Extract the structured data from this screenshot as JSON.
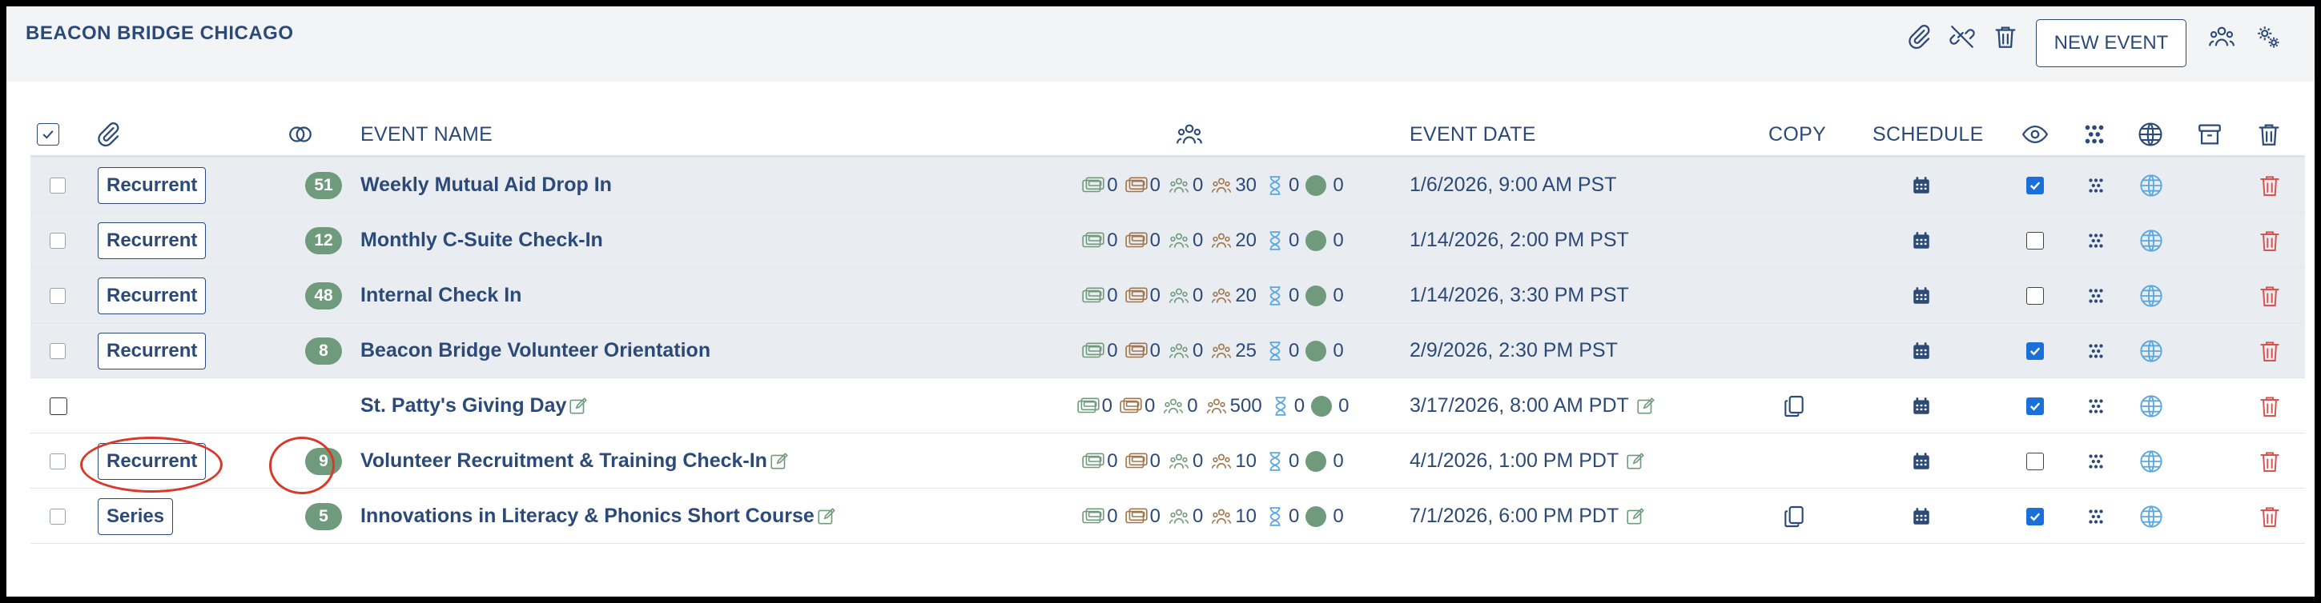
{
  "org": {
    "title": "BEACON BRIDGE CHICAGO"
  },
  "toolbar": {
    "new_event_label": "NEW EVENT",
    "icons": [
      "paperclip-icon",
      "unlink-icon",
      "trash-icon",
      "users-icon",
      "gears-icon"
    ]
  },
  "columns": {
    "event_name": "EVENT NAME",
    "event_date": "EVENT DATE",
    "copy": "COPY",
    "schedule": "SCHEDULE"
  },
  "colors": {
    "primary": "#2c4a78",
    "badge_green": "#6f9a7c",
    "row_shade": "#e9ecf1",
    "checkbox_blue": "#1a6fd8",
    "trash_red": "#d9534f",
    "globe_blue": "#5aa7e0",
    "annotation_red": "#d83a2a"
  },
  "rows": [
    {
      "tag": "Recurrent",
      "count": "51",
      "name": "Weekly Mutual Aid Drop In",
      "editable": false,
      "s1": "0",
      "s2": "0",
      "s3": "0",
      "s4": "30",
      "s5": "0",
      "s6": "0",
      "date": "1/6/2026, 9:00 AM PST",
      "copy": false,
      "visible": true
    },
    {
      "tag": "Recurrent",
      "count": "12",
      "name": "Monthly C-Suite Check-In",
      "editable": false,
      "s1": "0",
      "s2": "0",
      "s3": "0",
      "s4": "20",
      "s5": "0",
      "s6": "0",
      "date": "1/14/2026, 2:00 PM PST",
      "copy": false,
      "visible": false
    },
    {
      "tag": "Recurrent",
      "count": "48",
      "name": "Internal Check In",
      "editable": false,
      "s1": "0",
      "s2": "0",
      "s3": "0",
      "s4": "20",
      "s5": "0",
      "s6": "0",
      "date": "1/14/2026, 3:30 PM PST",
      "copy": false,
      "visible": false
    },
    {
      "tag": "Recurrent",
      "count": "8",
      "name": "Beacon Bridge Volunteer Orientation",
      "editable": false,
      "s1": "0",
      "s2": "0",
      "s3": "0",
      "s4": "25",
      "s5": "0",
      "s6": "0",
      "date": "2/9/2026, 2:30 PM PST",
      "copy": false,
      "visible": true
    },
    {
      "tag": "",
      "count": "",
      "name": "St. Patty's Giving Day",
      "editable": true,
      "s1": "0",
      "s2": "0",
      "s3": "0",
      "s4": "500",
      "s5": "0",
      "s6": "0",
      "date": "3/17/2026, 8:00 AM PDT",
      "copy": true,
      "visible": true
    },
    {
      "tag": "Recurrent",
      "count": "9",
      "name": "Volunteer Recruitment & Training Check-In",
      "editable": true,
      "s1": "0",
      "s2": "0",
      "s3": "0",
      "s4": "10",
      "s5": "0",
      "s6": "0",
      "date": "4/1/2026, 1:00 PM PDT",
      "copy": false,
      "visible": false
    },
    {
      "tag": "Series",
      "count": "5",
      "name": "Innovations in Literacy & Phonics Short Course",
      "editable": true,
      "s1": "0",
      "s2": "0",
      "s3": "0",
      "s4": "10",
      "s5": "0",
      "s6": "0",
      "date": "7/1/2026, 6:00 PM PDT",
      "copy": true,
      "visible": true
    }
  ]
}
